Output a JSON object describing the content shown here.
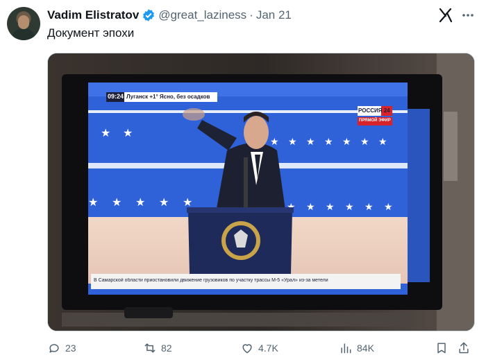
{
  "tweet": {
    "author_name": "Vadim Elistratov",
    "handle": "@great_laziness",
    "separator": "·",
    "date": "Jan 21",
    "text": "Документ эпохи"
  },
  "media": {
    "tv_clock": "09:24",
    "tv_weather": "Луганск  +1°  Ясно, без осадков",
    "tv_channel": "РОССИЯ 24",
    "tv_live": "ПРЯМОЙ ЭФИР",
    "tv_ticker": "В Самарской области приостановили движение грузовиков по участку трассы М-5 «Урал» из-за метели"
  },
  "actions": {
    "replies": "23",
    "reposts": "82",
    "likes": "4.7K",
    "views": "84K"
  },
  "colors": {
    "accent": "#1d9bf0",
    "muted": "#536471",
    "stage_blue": "#2a5fd6"
  },
  "icons": [
    "verified-badge-icon",
    "grok-icon",
    "reply-icon",
    "repost-icon",
    "like-icon",
    "views-icon",
    "bookmark-icon",
    "share-icon"
  ]
}
